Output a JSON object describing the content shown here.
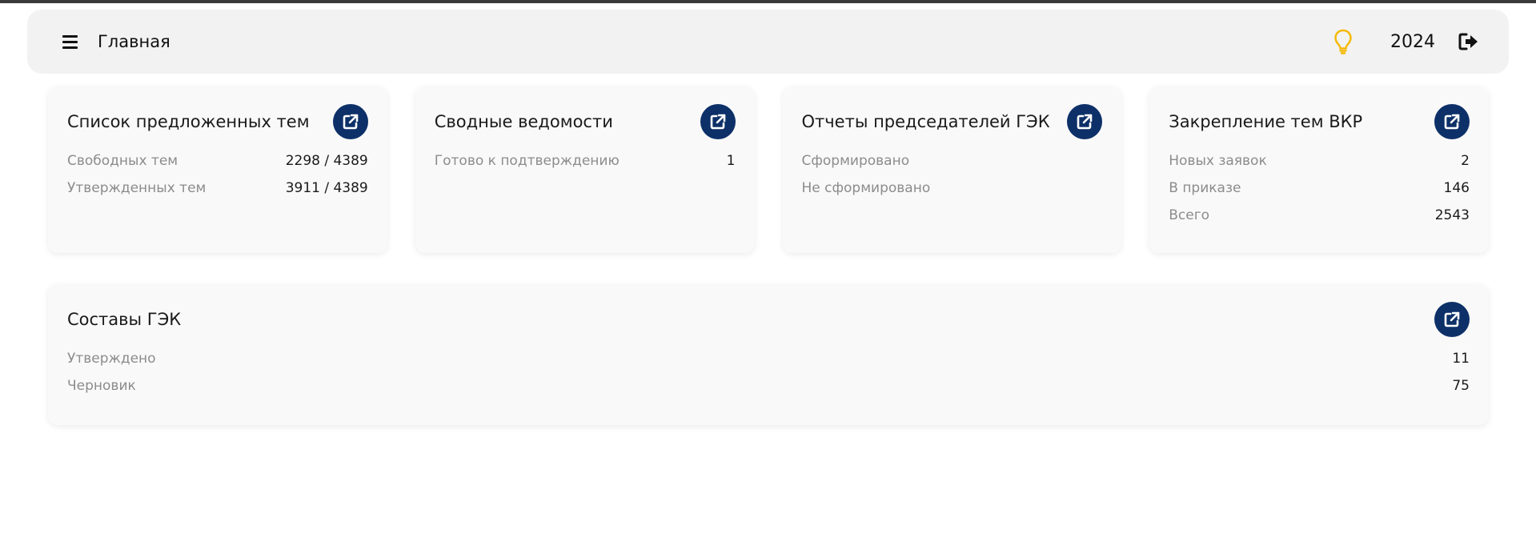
{
  "header": {
    "title": "Главная",
    "year": "2024",
    "bulb_icon": "lightbulb-icon",
    "logout_icon": "logout-icon",
    "bulb_color": "#f5b800"
  },
  "accent_color": "#0d3068",
  "cards": [
    {
      "title": "Список предложенных тем",
      "rows": [
        {
          "label": "Свободных тем",
          "value": "2298 / 4389"
        },
        {
          "label": "Утвержденных тем",
          "value": "3911 / 4389"
        }
      ]
    },
    {
      "title": "Сводные ведомости",
      "rows": [
        {
          "label": "Готово к подтверждению",
          "value": "1"
        }
      ]
    },
    {
      "title": "Отчеты председателей ГЭК",
      "rows": [
        {
          "label": "Сформировано",
          "value": ""
        },
        {
          "label": "Не сформировано",
          "value": ""
        }
      ]
    },
    {
      "title": "Закрепление тем ВКР",
      "rows": [
        {
          "label": "Новых заявок",
          "value": "2"
        },
        {
          "label": "В приказе",
          "value": "146"
        },
        {
          "label": "Всего",
          "value": "2543"
        }
      ]
    }
  ],
  "wide_card": {
    "title": "Составы ГЭК",
    "rows": [
      {
        "label": "Утверждено",
        "value": "11"
      },
      {
        "label": "Черновик",
        "value": "75"
      }
    ]
  }
}
